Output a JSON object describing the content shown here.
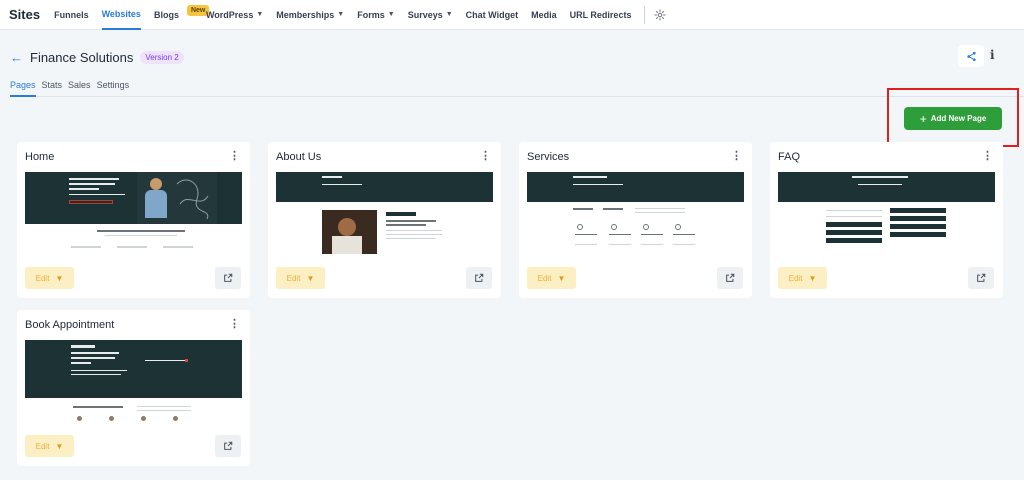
{
  "nav": {
    "brand": "Sites",
    "items": [
      {
        "label": "Funnels",
        "has_dropdown": false,
        "active": false
      },
      {
        "label": "Websites",
        "has_dropdown": false,
        "active": true
      },
      {
        "label": "Blogs",
        "has_dropdown": false,
        "active": false,
        "badge": "New"
      },
      {
        "label": "WordPress",
        "has_dropdown": true,
        "active": false
      },
      {
        "label": "Memberships",
        "has_dropdown": true,
        "active": false
      },
      {
        "label": "Forms",
        "has_dropdown": true,
        "active": false
      },
      {
        "label": "Surveys",
        "has_dropdown": true,
        "active": false
      },
      {
        "label": "Chat Widget",
        "has_dropdown": false,
        "active": false
      },
      {
        "label": "Media",
        "has_dropdown": false,
        "active": false
      },
      {
        "label": "URL Redirects",
        "has_dropdown": false,
        "active": false
      }
    ],
    "settings_icon": "gear-icon"
  },
  "header": {
    "back_icon": "arrow-left-icon",
    "title": "Finance Solutions",
    "version": "Version 2",
    "share_icon": "share-icon",
    "info_icon": "info-icon"
  },
  "tabs": [
    {
      "label": "Pages",
      "active": true
    },
    {
      "label": "Stats",
      "active": false
    },
    {
      "label": "Sales",
      "active": false
    },
    {
      "label": "Settings",
      "active": false
    }
  ],
  "add_button": {
    "label": "Add New Page",
    "icon": "plus-icon",
    "highlight_color": "#e02020"
  },
  "cards": [
    {
      "title": "Home",
      "edit_label": "Edit"
    },
    {
      "title": "About Us",
      "edit_label": "Edit"
    },
    {
      "title": "Services",
      "edit_label": "Edit"
    },
    {
      "title": "FAQ",
      "edit_label": "Edit"
    },
    {
      "title": "Book Appointment",
      "edit_label": "Edit"
    }
  ],
  "colors": {
    "accent": "#2b7bd8",
    "primary_button": "#2e9e3a",
    "version_badge": "#7c3aed",
    "edit_button": "#fcefc4"
  }
}
